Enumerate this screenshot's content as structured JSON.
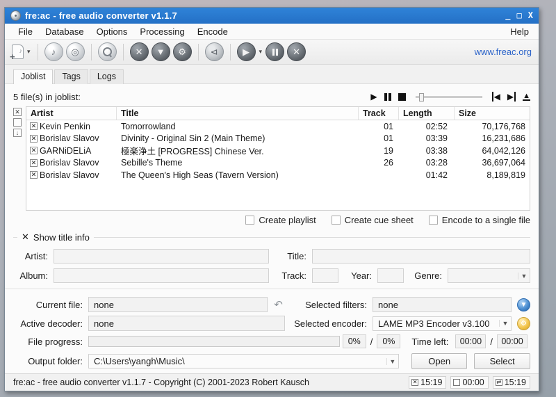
{
  "window": {
    "title": "fre:ac - free audio converter v1.1.7",
    "controls": {
      "minimize": "_",
      "maximize": "□",
      "close": "X"
    }
  },
  "menu": {
    "items": [
      "File",
      "Database",
      "Options",
      "Processing",
      "Encode"
    ],
    "help": "Help"
  },
  "toolbar": {
    "website_link": "www.freac.org",
    "icon_names": [
      "add-files-icon",
      "music-note-icon",
      "cd-rip-icon",
      "search-icon",
      "tools-icon",
      "filter-icon",
      "gear-icon",
      "share-icon",
      "play-icon",
      "pause-icon",
      "stop-icon"
    ],
    "glyphs": {
      "music_note": "♪",
      "cd": "◎",
      "tools": "✕",
      "filter": "▼",
      "gear": "⚙",
      "share": "⊲",
      "play": "▶",
      "stop": "✕",
      "caret": "▾"
    }
  },
  "tabs": {
    "joblist": "Joblist",
    "tags": "Tags",
    "logs": "Logs"
  },
  "joblist": {
    "count_text": "5 file(s) in joblist:",
    "columns": {
      "artist": "Artist",
      "title": "Title",
      "track": "Track",
      "length": "Length",
      "size": "Size"
    },
    "rows": [
      {
        "artist": "Kevin Penkin",
        "title": "Tomorrowland",
        "track": "01",
        "length": "02:52",
        "size": "70,176,768"
      },
      {
        "artist": "Borislav Slavov",
        "title": "Divinity - Original Sin 2 (Main Theme)",
        "track": "01",
        "length": "03:39",
        "size": "16,231,686"
      },
      {
        "artist": "GARNiDELiA",
        "title": "極楽浄土 [PROGRESS] Chinese Ver.",
        "track": "19",
        "length": "03:38",
        "size": "64,042,126"
      },
      {
        "artist": "Borislav Slavov",
        "title": "Sebille's Theme",
        "track": "26",
        "length": "03:28",
        "size": "36,697,064"
      },
      {
        "artist": "Borislav Slavov",
        "title": "The Queen's High Seas (Tavern Version)",
        "track": "",
        "length": "01:42",
        "size": "8,189,819"
      }
    ],
    "row_checkbox_glyph": "✕",
    "select_all_glyph": "✕",
    "playback_glyphs": {
      "play": "▶",
      "stop": "",
      "prev": "◀",
      "next": "▶",
      "eject": "▲"
    }
  },
  "options_row": {
    "create_playlist": "Create playlist",
    "create_cue_sheet": "Create cue sheet",
    "encode_single_file": "Encode to a single file"
  },
  "title_info": {
    "header": "Show title info",
    "collapse_glyph": "✕",
    "artist_label": "Artist:",
    "album_label": "Album:",
    "title_label": "Title:",
    "track_label": "Track:",
    "year_label": "Year:",
    "genre_label": "Genre:"
  },
  "converter": {
    "current_file_label": "Current file:",
    "current_file_value": "none",
    "active_decoder_label": "Active decoder:",
    "active_decoder_value": "none",
    "selected_filters_label": "Selected filters:",
    "selected_filters_value": "none",
    "selected_encoder_label": "Selected encoder:",
    "selected_encoder_value": "LAME MP3 Encoder v3.100",
    "file_progress_label": "File progress:",
    "progress_current": "0%",
    "progress_total": "0%",
    "slash": "/",
    "time_left_label": "Time left:",
    "time_left_current": "00:00",
    "time_left_total": "00:00",
    "output_folder_label": "Output folder:",
    "output_folder_value": "C:\\Users\\yangh\\Music\\",
    "open_button": "Open",
    "select_button": "Select"
  },
  "statusbar": {
    "text": "fre:ac - free audio converter v1.1.7 - Copyright (C) 2001-2023 Robert Kausch",
    "time1": "15:19",
    "time2": "00:00",
    "time3": "15:19",
    "icon1_glyph": "✕",
    "icon2_glyph": "",
    "icon3_glyph": "⇄"
  }
}
